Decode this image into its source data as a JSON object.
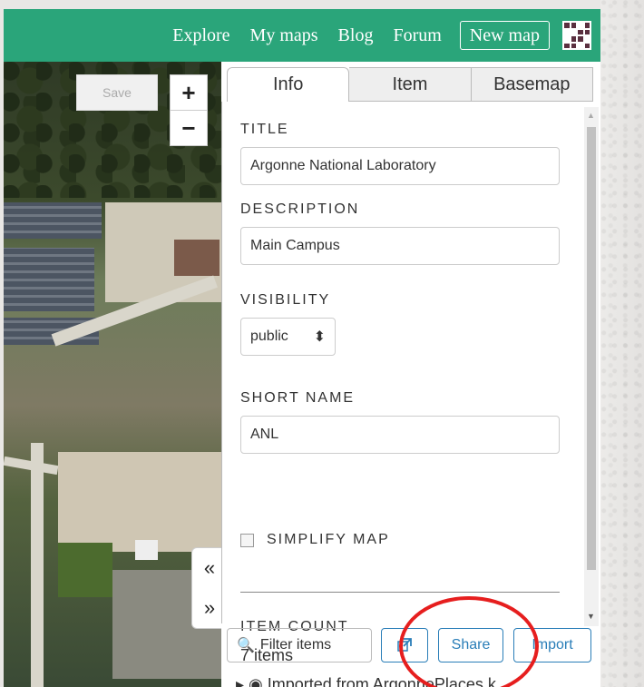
{
  "nav": {
    "links": [
      "Explore",
      "My maps",
      "Blog",
      "Forum"
    ],
    "new_map": "New map"
  },
  "map": {
    "save_label": "Save",
    "zoom_in": "+",
    "zoom_out": "−",
    "collapse_left": "«",
    "collapse_right": "»"
  },
  "panel": {
    "tabs": [
      "Info",
      "Item",
      "Basemap"
    ],
    "active_tab": "Info",
    "title_label": "TITLE",
    "title_value": "Argonne National Laboratory",
    "description_label": "DESCRIPTION",
    "description_value": "Main Campus",
    "visibility_label": "VISIBILITY",
    "visibility_value": "public",
    "short_name_label": "SHORT NAME",
    "short_name_value": "ANL",
    "simplify_label": "SIMPLIFY MAP",
    "item_count_label": "ITEM COUNT",
    "item_count_value": "7 items"
  },
  "toolbar": {
    "filter_placeholder": "Filter items",
    "share_label": "Share",
    "import_label": "Import"
  },
  "list": {
    "row_text": "▸ ◉ Imported from ArgonnePlaces.k"
  },
  "colors": {
    "topbar": "#2aa57a",
    "button_accent": "#2a7eb8",
    "annotation_circle": "#e61e1e"
  }
}
